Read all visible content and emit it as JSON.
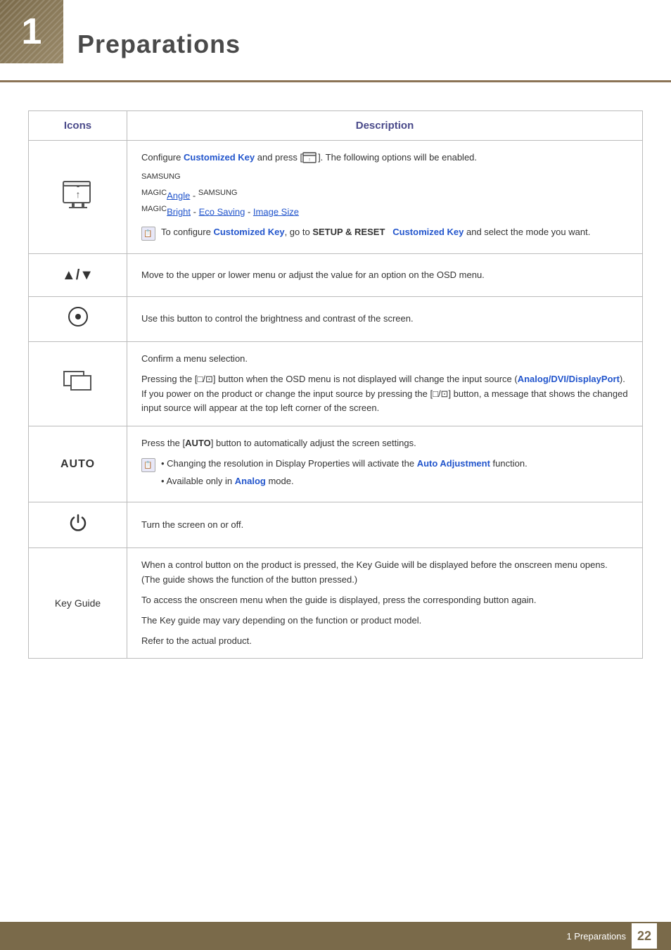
{
  "header": {
    "number": "1",
    "title": "Preparations"
  },
  "table": {
    "columns": [
      "Icons",
      "Description"
    ],
    "rows": [
      {
        "icon_type": "monitor",
        "icon_label": "monitor-up-icon",
        "description": {
          "main_text": "Configure Customized Key and press [",
          "monitor_inline": true,
          "main_text2": "]. The following options will be enabled.",
          "links_line": "SAMSUNGMAGICAngle - SAMSUNGMAGICBright - Eco Saving - Image Size",
          "note": "To configure Customized Key, go to SETUP & RESET   Customized Key and select the mode you want."
        }
      },
      {
        "icon_type": "arrows",
        "icon_label": "up-down-arrows-icon",
        "description": {
          "main_text": "Move to the upper or lower menu or adjust the value for an option on the OSD menu."
        }
      },
      {
        "icon_type": "circle-dot",
        "icon_label": "circle-dot-icon",
        "description": {
          "main_text": "Use this button to control the brightness and contrast of the screen."
        }
      },
      {
        "icon_type": "source",
        "icon_label": "source-icon",
        "description": {
          "para1": "Confirm a menu selection.",
          "para2": "Pressing the [□/⊡] button when the OSD menu is not displayed will change the input source (Analog/DVI/DisplayPort). If you power on the product or change the input source by pressing the [□/⊡] button, a message that shows the changed input source will appear at the top left corner of the screen."
        }
      },
      {
        "icon_type": "auto",
        "icon_label": "auto-text-icon",
        "description": {
          "para1": "Press the [AUTO] button to automatically adjust the screen settings.",
          "bullets": [
            "Changing the resolution in Display Properties will activate the Auto Adjustment function.",
            "Available only in Analog mode."
          ]
        }
      },
      {
        "icon_type": "power",
        "icon_label": "power-icon",
        "description": {
          "main_text": "Turn the screen on or off."
        }
      },
      {
        "icon_type": "text",
        "icon_label": "key-guide-label",
        "icon_text": "Key Guide",
        "description": {
          "para1": "When a control button on the product is pressed, the Key Guide will be displayed before the onscreen menu opens. (The guide shows the function of the button pressed.)",
          "para2": "To access the onscreen menu when the guide is displayed, press the corresponding button again.",
          "para3": "The Key guide may vary depending on the function or product model.",
          "para4": "Refer to the actual product."
        }
      }
    ]
  },
  "footer": {
    "text": "1 Preparations",
    "page_number": "22"
  }
}
